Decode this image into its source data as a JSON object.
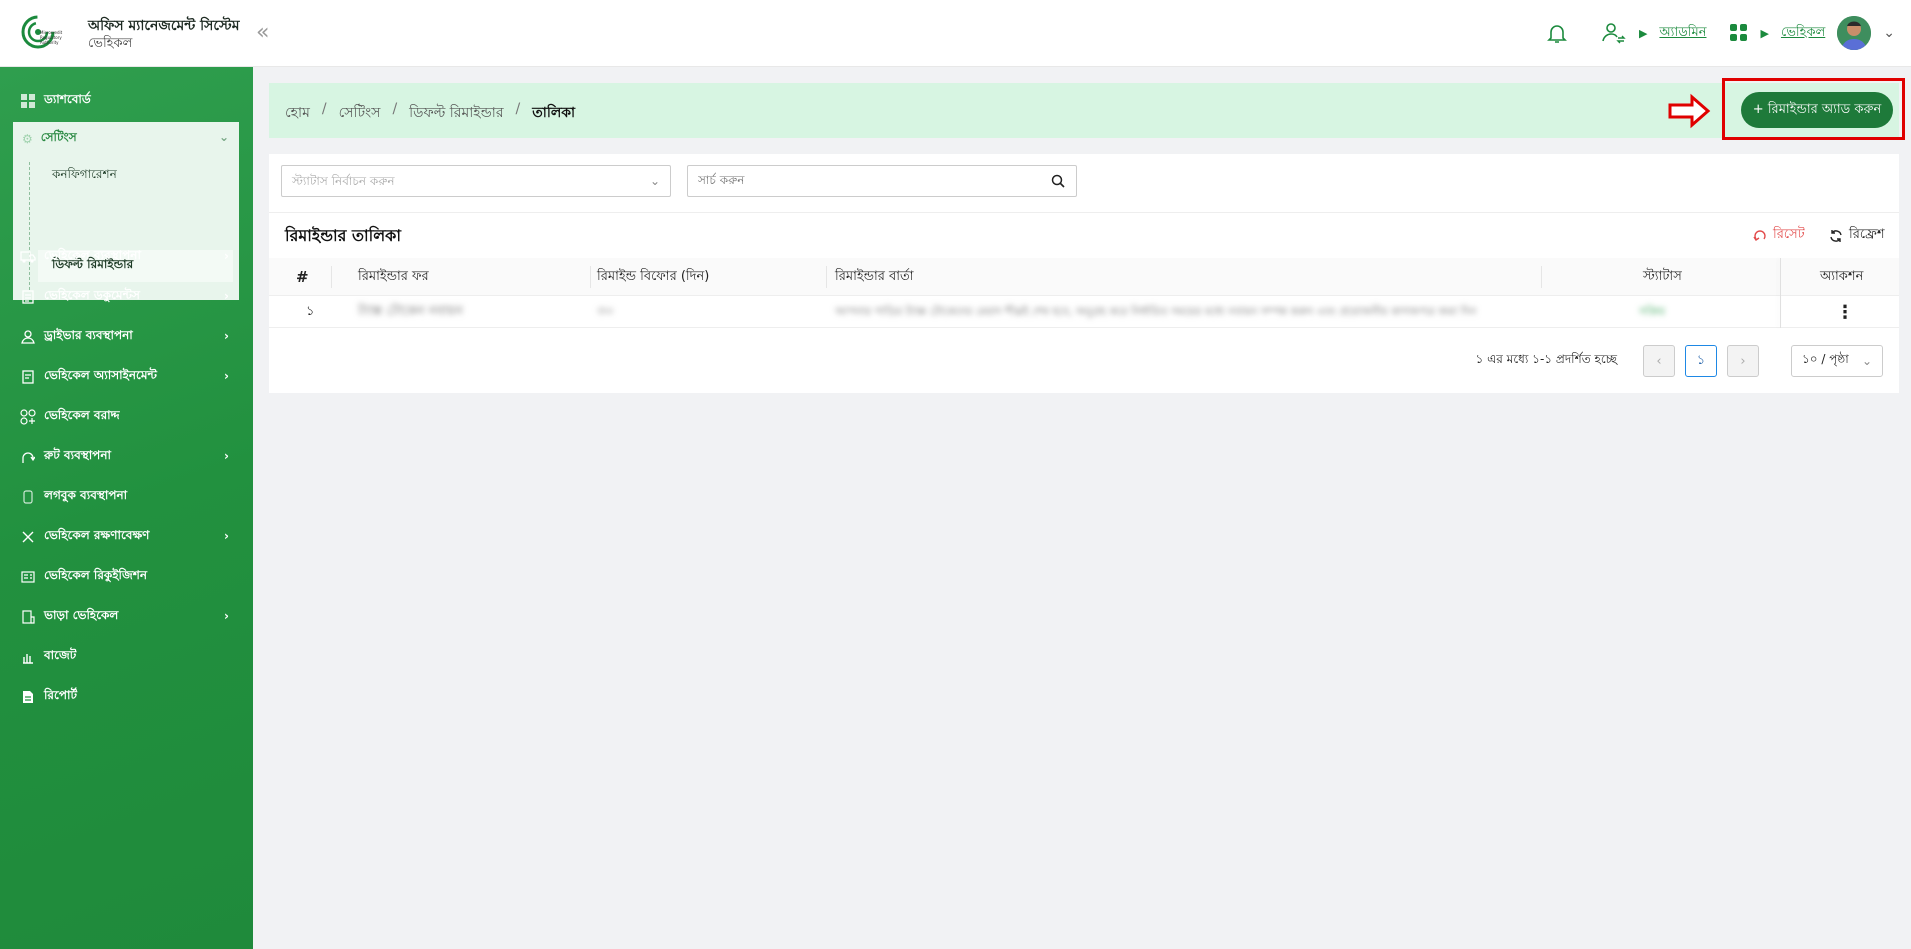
{
  "app": {
    "logo_text": "Microcredit Regulatory Authority",
    "title": "অফিস ম্যানেজমেন্ট সিস্টেম",
    "subtitle": "ভেহিকল"
  },
  "header": {
    "user_link": "অ্যাডমিন",
    "module_link": "ভেহিকল"
  },
  "sidebar": {
    "items": [
      {
        "label": "ড্যাশবোর্ড",
        "icon": "dashboard-icon"
      },
      {
        "label": "সেটিংস",
        "icon": "settings-icon"
      },
      {
        "label": "ভেহিকেল ব্যবস্থাপনা",
        "icon": "truck-icon"
      },
      {
        "label": "ভেহিকেল ডকুমেন্টস",
        "icon": "documents-icon"
      },
      {
        "label": "ড্রাইভার ব্যবস্থাপনা",
        "icon": "driver-icon"
      },
      {
        "label": "ভেহিকেল অ্যাসাইনমেন্ট",
        "icon": "assignment-icon"
      },
      {
        "label": "ভেহিকেল বরাদ্দ",
        "icon": "allocation-icon"
      },
      {
        "label": "রুট ব্যবস্থাপনা",
        "icon": "route-icon"
      },
      {
        "label": "লগবুক ব্যবস্থাপনা",
        "icon": "logbook-icon"
      },
      {
        "label": "ভেহিকেল রক্ষণাবেক্ষণ",
        "icon": "maintenance-icon"
      },
      {
        "label": "ভেহিকেল রিকুইজিশন",
        "icon": "requisition-icon"
      },
      {
        "label": "ভাড়া ভেহিকেল",
        "icon": "rental-icon"
      },
      {
        "label": "বাজেট",
        "icon": "budget-icon"
      },
      {
        "label": "রিপোর্ট",
        "icon": "report-icon"
      }
    ],
    "settings_sub": [
      "কনফিগারেশন",
      "ডিফল্ট রিমাইন্ডার"
    ]
  },
  "breadcrumb": {
    "items": [
      "হোম",
      "সেটিংস",
      "ডিফল্ট রিমাইন্ডার",
      "তালিকা"
    ]
  },
  "add_button": "+ রিমাইন্ডার অ্যাড করুন",
  "filters": {
    "status_placeholder": "স্ট্যাটাস নির্বাচন করুন",
    "search_placeholder": "সার্চ করুন"
  },
  "table": {
    "title": "রিমাইন্ডার তালিকা",
    "reset": "রিসেট",
    "refresh": "রিফ্রেশ",
    "columns": [
      "#",
      "রিমাইন্ডার ফর",
      "রিমাইন্ড বিফোর (দিন)",
      "রিমাইন্ডার বার্তা",
      "স্ট্যাটাস",
      "অ্যাকশন"
    ],
    "rows": [
      {
        "index": "১",
        "reminder_for": "ট্যাক্স টোকেন নবায়ন",
        "before_days": "৩০",
        "message": "আপনার গাড়ির ট্যাক্স টোকেনের মেয়াদ শীঘ্রই শেষ হবে, অনুগ্রহ করে নির্ধারিত সময়ের মধ্যে নবায়ন সম্পন্ন করুন এবং প্রয়োজনীয় কাগজপত্র জমা দিন",
        "status": "সক্রিয়"
      }
    ]
  },
  "pagination": {
    "info": "১ এর মধ্যে ১-১ প্রদর্শিত হচ্ছে",
    "current_page": "১",
    "page_size": "১০ / পৃষ্ঠা"
  },
  "colors": {
    "sidebar": "#22913f",
    "accent": "#1e7a3a",
    "breadcrumb_bg": "#d7f5e2",
    "highlight": "#e00000",
    "reset": "#e24a4a"
  }
}
